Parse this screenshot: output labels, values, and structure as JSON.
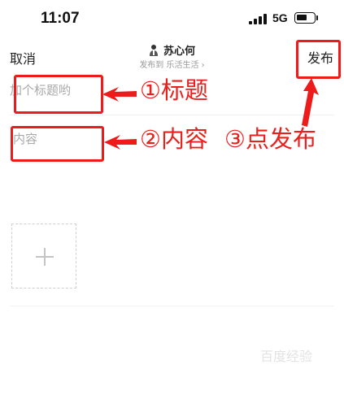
{
  "status_bar": {
    "time": "11:07",
    "network": "5G"
  },
  "header": {
    "cancel_label": "取消",
    "author_name": "苏心何",
    "publish_to": "发布到 乐活生活 ›",
    "publish_label": "发布"
  },
  "editor": {
    "title_placeholder": "加个标题哟",
    "content_placeholder": "内容"
  },
  "annotations": {
    "step1": "①标题",
    "step2": "②内容",
    "step3": "③点发布",
    "color": "#e8211d"
  },
  "watermark": "百度经验"
}
